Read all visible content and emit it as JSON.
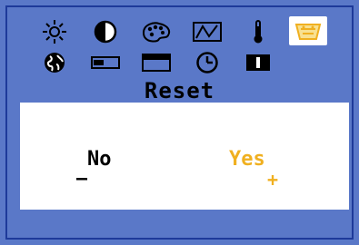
{
  "menu": {
    "icons_row1": [
      "brightness-icon",
      "contrast-icon",
      "color-palette-icon",
      "geometry-waveform-icon",
      "temperature-icon",
      "reset-icon"
    ],
    "icons_row2": [
      "language-globe-icon",
      "h-position-icon",
      "v-position-icon",
      "clock-icon",
      "information-icon"
    ],
    "selected_icon": "reset-icon"
  },
  "page": {
    "title": "Reset"
  },
  "options": {
    "no_label": "No",
    "yes_label": "Yes",
    "minus_mark": "–",
    "plus_mark": "+"
  },
  "colors": {
    "background": "#5a78c8",
    "frame": "#1e3a9a",
    "panel": "#ffffff",
    "highlight": "#f0b020",
    "icon_highlight": "#f0c040"
  }
}
